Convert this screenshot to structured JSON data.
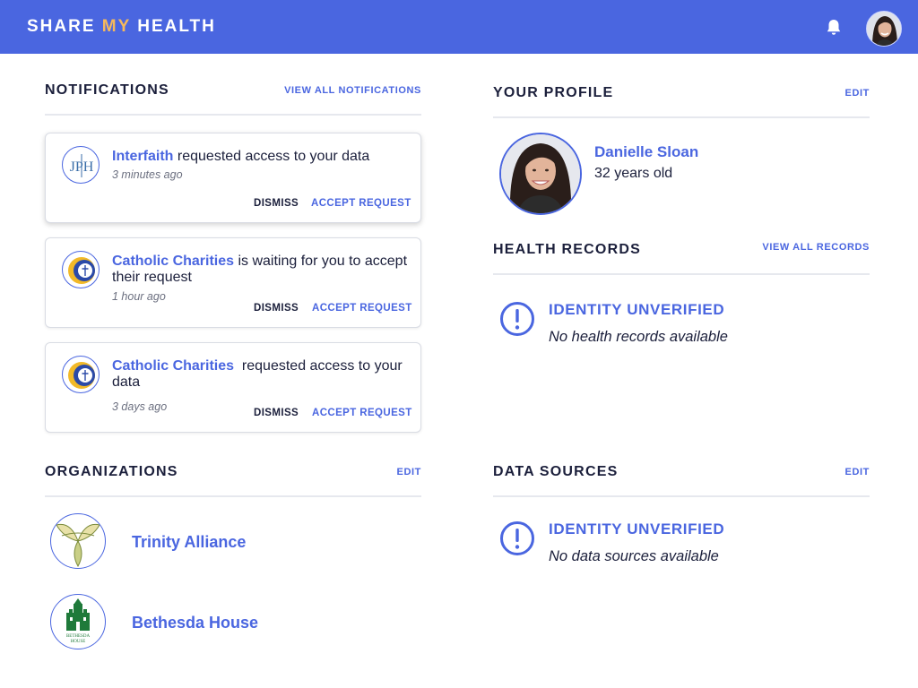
{
  "header": {
    "brand_part1": "SHARE ",
    "brand_part2": "MY",
    "brand_part3": " HEALTH",
    "icons": {
      "notifications": "bell-icon",
      "avatar": "user-avatar"
    }
  },
  "notifications": {
    "title": "NOTIFICATIONS",
    "view_all": "VIEW ALL NOTIFICATIONS",
    "items": [
      {
        "org": "Interfaith",
        "text": " requested access to your data",
        "time": "3 minutes ago",
        "dismiss": "DISMISS",
        "accept": "ACCEPT REQUEST"
      },
      {
        "org": "Catholic Charities",
        "text": " is waiting for you to accept their request",
        "time": "1 hour ago",
        "dismiss": "DISMISS",
        "accept": "ACCEPT REQUEST"
      },
      {
        "org": "Catholic Charities",
        "text": "  requested access to your data",
        "time": "3 days ago",
        "dismiss": "DISMISS",
        "accept": "ACCEPT REQUEST"
      }
    ]
  },
  "profile": {
    "title": "YOUR PROFILE",
    "edit": "EDIT",
    "name": "Danielle Sloan",
    "age": "32 years old"
  },
  "health_records": {
    "title": "HEALTH RECORDS",
    "view_all": "VIEW ALL RECORDS",
    "status": "IDENTITY UNVERIFIED",
    "message": "No health records available"
  },
  "organizations": {
    "title": "ORGANIZATIONS",
    "edit": "EDIT",
    "items": [
      {
        "name": "Trinity Alliance"
      },
      {
        "name": "Bethesda House",
        "logo_text_1": "BETHESDA",
        "logo_text_2": "HOUSE"
      }
    ]
  },
  "data_sources": {
    "title": "DATA SOURCES",
    "edit": "EDIT",
    "status": "IDENTITY UNVERIFIED",
    "message": "No data sources available"
  },
  "colors": {
    "primary": "#4a66e0",
    "accent": "#f5b95c",
    "text": "#1b1f3b",
    "muted": "#6c7080",
    "divider": "#e6e8ee"
  }
}
